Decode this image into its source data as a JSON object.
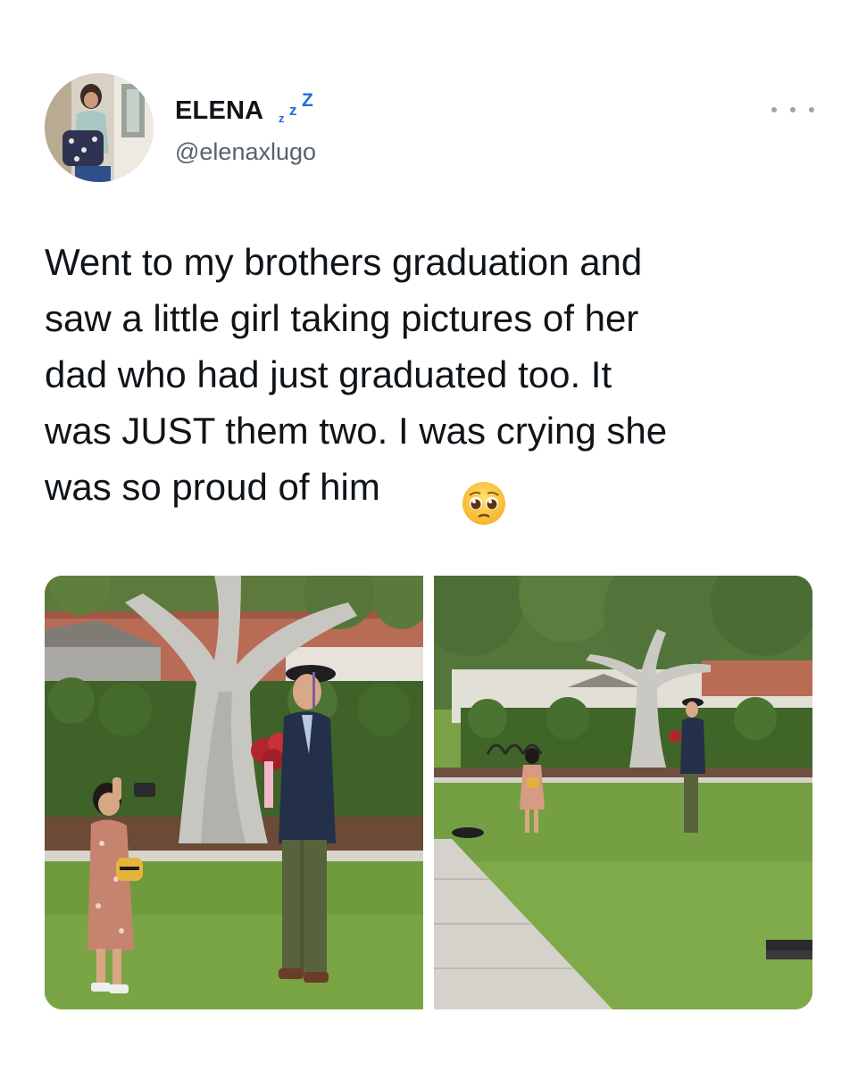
{
  "tweet": {
    "display_name": "ELENA",
    "display_name_suffix_icon": "sleeping-zzz-icon",
    "handle": "@elenaxlugo",
    "more_icon": "more-horizontal-icon",
    "text": "Went to my brothers graduation and\nsaw a little girl taking pictures of her\ndad who had just graduated too. It\nwas JUST them two. I was crying she\nwas so proud of him",
    "text_emoji_icon": "pleading-face-emoji",
    "media": {
      "count": 2,
      "photos": [
        "photo",
        "photo"
      ]
    }
  },
  "colors": {
    "text": "#0f1419",
    "secondary_text": "#536471",
    "zzz_blue": "#1d6fd8",
    "grass": "#6f9b3c",
    "hedge": "#3c5e25"
  }
}
